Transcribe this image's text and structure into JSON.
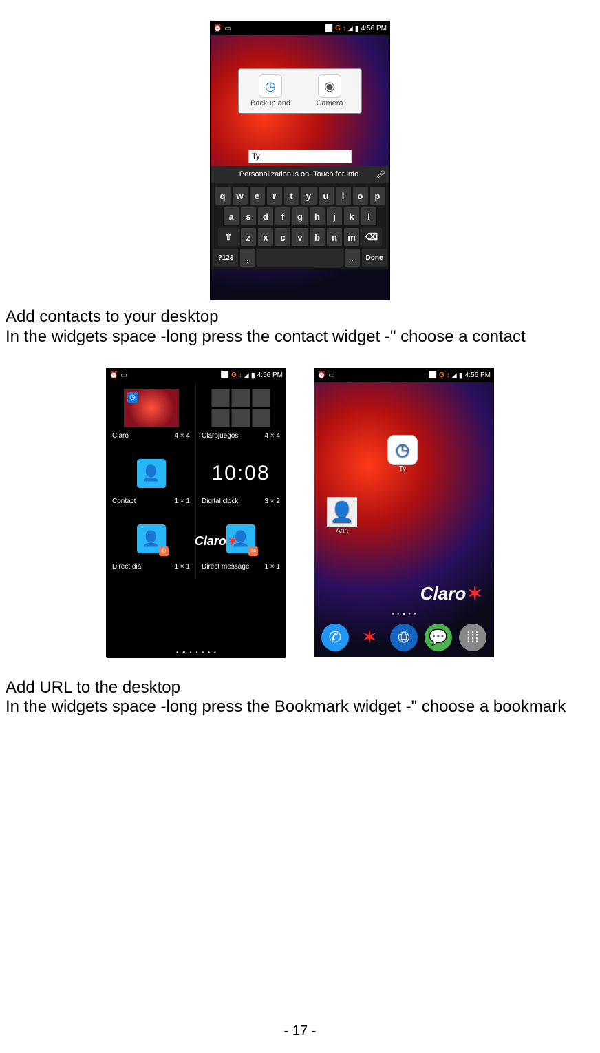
{
  "status": {
    "time": "4:56 PM",
    "net_label": "G",
    "net_arrows": "↕"
  },
  "phone1": {
    "popup": {
      "item1": "Backup and",
      "item2": "Camera",
      "input": "Ty"
    },
    "info": "Personalization is on. Touch for info.",
    "kb": {
      "r1": [
        "q",
        "w",
        "e",
        "r",
        "t",
        "y",
        "u",
        "i",
        "o",
        "p"
      ],
      "r2": [
        "a",
        "s",
        "d",
        "f",
        "g",
        "h",
        "j",
        "k",
        "l"
      ],
      "r3_shift": "⇧",
      "r3": [
        "z",
        "x",
        "c",
        "v",
        "b",
        "n",
        "m"
      ],
      "r3_del": "⌫",
      "r4_sym": "?123",
      "r4_comma": ",",
      "r4_dot": ".",
      "r4_done": "Done"
    }
  },
  "text1_line1": "Add contacts to your desktop",
  "text1_line2": "In the widgets space -long press the contact widget -\" choose a contact",
  "widgets": {
    "cells": [
      {
        "name": "Claro",
        "size": "4 × 4",
        "type": "claro-thumb"
      },
      {
        "name": "Clarojuegos",
        "size": "4 × 4",
        "type": "grid"
      },
      {
        "name": "Contact",
        "size": "1 × 1",
        "type": "contact"
      },
      {
        "name": "Digital clock",
        "size": "3 × 2",
        "type": "clock",
        "clock": "10:08"
      },
      {
        "name": "Direct dial",
        "size": "1 × 1",
        "type": "contact-badge"
      },
      {
        "name": "Direct message",
        "size": "1 × 1",
        "type": "contact-badge"
      }
    ],
    "brand_overlay": "Claro"
  },
  "home": {
    "icon1_label": "Ty",
    "icon2_label": "Ann",
    "brand": "Claro"
  },
  "text2_line1": "Add URL to the desktop",
  "text2_line2": "In the widgets space -long press the Bookmark widget -\" choose a bookmark",
  "page_number": "- 17 -"
}
